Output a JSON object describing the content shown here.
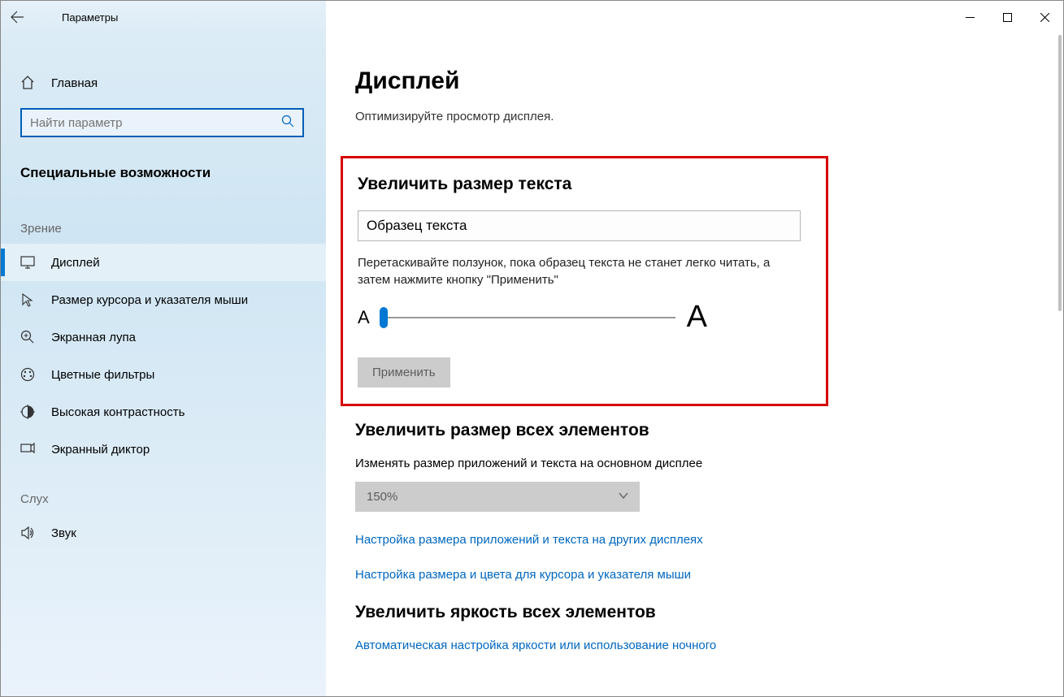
{
  "window": {
    "app_title": "Параметры"
  },
  "sidebar": {
    "home_label": "Главная",
    "search_placeholder": "Найти параметр",
    "section_header": "Специальные возможности",
    "cat_vision": "Зрение",
    "cat_hearing": "Слух",
    "items": [
      {
        "label": "Дисплей"
      },
      {
        "label": "Размер курсора и указателя мыши"
      },
      {
        "label": "Экранная лупа"
      },
      {
        "label": "Цветные фильтры"
      },
      {
        "label": "Высокая контрастность"
      },
      {
        "label": "Экранный диктор"
      }
    ],
    "hearing_items": [
      {
        "label": "Звук"
      }
    ]
  },
  "main": {
    "page_title": "Дисплей",
    "subtitle": "Оптимизируйте просмотр дисплея.",
    "text_size": {
      "heading": "Увеличить размер текста",
      "sample": "Образец текста",
      "hint": "Перетаскивайте ползунок, пока образец текста не станет легко читать, а затем нажмите кнопку \"Применить\"",
      "letter_small": "A",
      "letter_big": "A",
      "apply": "Применить"
    },
    "all_size": {
      "heading": "Увеличить размер всех элементов",
      "desc": "Изменять размер приложений и текста на основном дисплее",
      "select_value": "150%",
      "link1": "Настройка размера приложений и текста на других дисплеях",
      "link2": "Настройка размера и цвета для курсора и указателя мыши"
    },
    "brightness": {
      "heading": "Увеличить яркость всех элементов",
      "link": "Автоматическая настройка яркости или использование ночного"
    }
  }
}
